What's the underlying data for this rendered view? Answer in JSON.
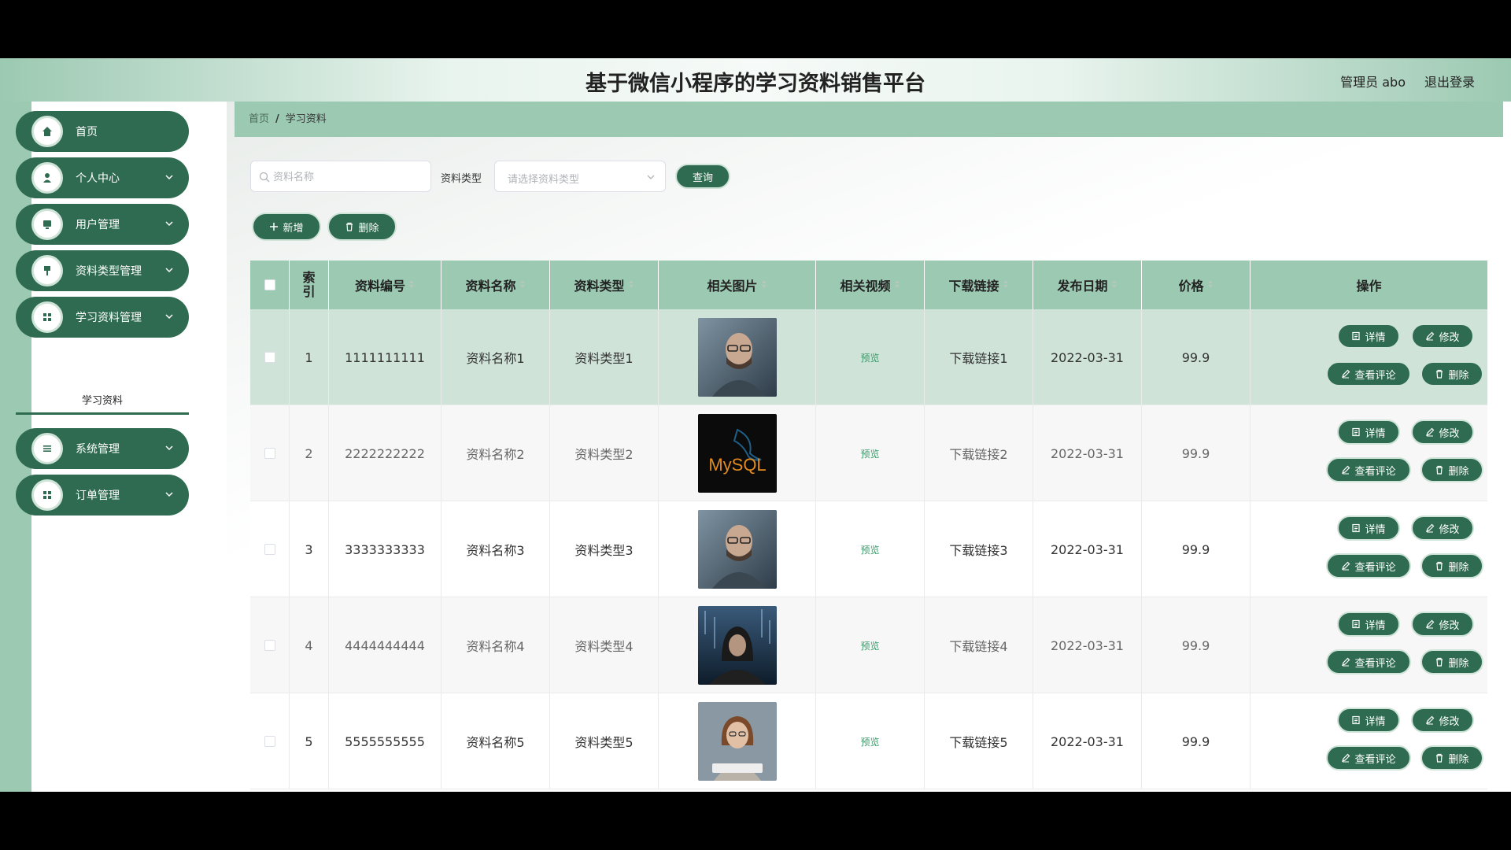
{
  "header": {
    "title": "基于微信小程序的学习资料销售平台",
    "user": "管理员 abo",
    "logout": "退出登录"
  },
  "sidebar": {
    "items": [
      {
        "label": "首页",
        "icon": "home-icon"
      },
      {
        "label": "个人中心",
        "icon": "user-icon"
      },
      {
        "label": "用户管理",
        "icon": "monitor-icon"
      },
      {
        "label": "资料类型管理",
        "icon": "pin-icon"
      },
      {
        "label": "学习资料管理",
        "icon": "grid-icon"
      },
      {
        "label": "系统管理",
        "icon": "list-icon"
      },
      {
        "label": "订单管理",
        "icon": "grid-icon"
      }
    ],
    "submenu_active": "学习资料"
  },
  "breadcrumb": {
    "home": "首页",
    "sep": "/",
    "current": "学习资料"
  },
  "search": {
    "name_placeholder": "资料名称",
    "type_label": "资料类型",
    "type_placeholder": "请选择资料类型",
    "query_button": "查询"
  },
  "actions": {
    "add": "新增",
    "delete": "删除"
  },
  "table": {
    "headers": [
      "索引",
      "资料编号",
      "资料名称",
      "资料类型",
      "相关图片",
      "相关视频",
      "下载链接",
      "发布日期",
      "价格",
      "操作"
    ],
    "preview_label": "预览",
    "op_labels": {
      "detail": "详情",
      "edit": "修改",
      "comments": "查看评论",
      "delete": "删除"
    },
    "rows": [
      {
        "index": "1",
        "code": "1111111111",
        "name": "资料名称1",
        "type": "资料类型1",
        "image": "man-with-glasses",
        "link": "下载链接1",
        "date": "2022-03-31",
        "price": "99.9"
      },
      {
        "index": "2",
        "code": "2222222222",
        "name": "资料名称2",
        "type": "资料类型2",
        "image": "mysql-logo",
        "link": "下载链接2",
        "date": "2022-03-31",
        "price": "99.9"
      },
      {
        "index": "3",
        "code": "3333333333",
        "name": "资料名称3",
        "type": "资料类型3",
        "image": "man-with-glasses",
        "link": "下载链接3",
        "date": "2022-03-31",
        "price": "99.9"
      },
      {
        "index": "4",
        "code": "4444444444",
        "name": "资料名称4",
        "type": "资料类型4",
        "image": "hooded-hacker",
        "link": "下载链接4",
        "date": "2022-03-31",
        "price": "99.9"
      },
      {
        "index": "5",
        "code": "5555555555",
        "name": "资料名称5",
        "type": "资料类型5",
        "image": "girl-with-keyboard",
        "link": "下载链接5",
        "date": "2022-03-31",
        "price": "99.9"
      }
    ],
    "mysql_text": "MySQL"
  },
  "colors": {
    "primary": "#2e6b50",
    "accent": "#9cc9b2",
    "highlight_row": "#cfe3d8"
  }
}
